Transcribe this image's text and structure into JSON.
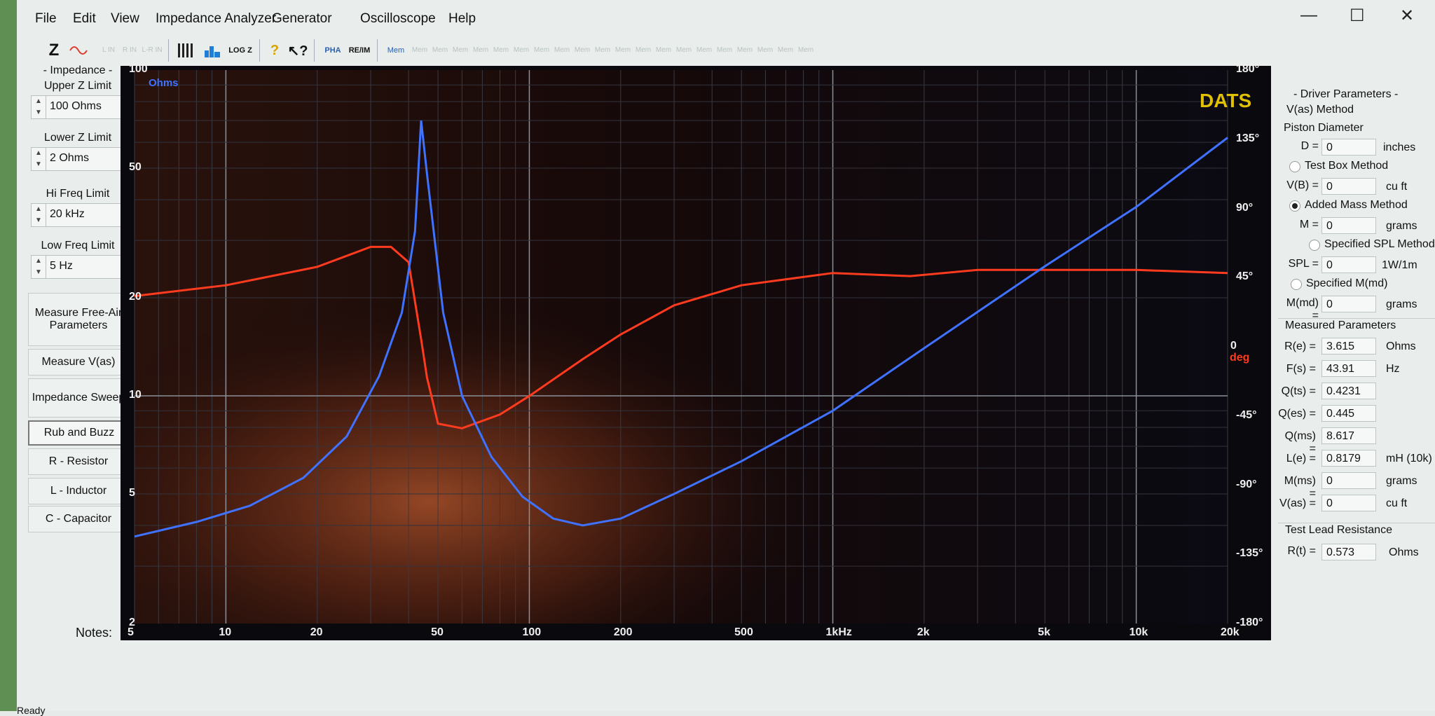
{
  "menu": [
    "File",
    "Edit",
    "View",
    "Impedance Analyzer",
    "Generator",
    "Oscilloscope",
    "Help"
  ],
  "window_controls": {
    "minimize": "—",
    "maximize": "☐",
    "close": "✕"
  },
  "toolbar": {
    "z_label": "Z",
    "ref_labels": [
      "L IN",
      "R IN",
      "L-R IN"
    ],
    "log_label": "LOG Z",
    "pha_label": "PHA",
    "reim_label": "RE/IM",
    "mem_label": "Mem",
    "mem_slots": [
      "Mem",
      "Mem",
      "Mem",
      "Mem",
      "Mem",
      "Mem",
      "Mem",
      "Mem",
      "Mem",
      "Mem",
      "Mem",
      "Mem",
      "Mem",
      "Mem",
      "Mem",
      "Mem",
      "Mem",
      "Mem",
      "Mem",
      "Mem"
    ]
  },
  "left_panel": {
    "impedance_title": "- Impedance -",
    "upper_z": {
      "label": "Upper Z Limit",
      "value": "100 Ohms"
    },
    "lower_z": {
      "label": "Lower Z Limit",
      "value": "2 Ohms"
    },
    "hi_freq": {
      "label": "Hi Freq Limit",
      "value": "20 kHz"
    },
    "low_freq": {
      "label": "Low Freq Limit",
      "value": "5 Hz"
    },
    "buttons": {
      "measure_free_air": "Measure Free-Air Parameters",
      "measure_vas": "Measure V(as)",
      "impedance_sweep": "Impedance Sweep",
      "rub_buzz": "Rub and Buzz",
      "resistor": "R - Resistor",
      "inductor": "L - Inductor",
      "capacitor": "C - Capacitor"
    }
  },
  "chart_labels": {
    "y_unit": "Ohms",
    "brand": "DATS",
    "phase_unit": "deg",
    "notes": "Notes:"
  },
  "chart_data": {
    "type": "line",
    "xlim": [
      5,
      20000
    ],
    "x_scale": "log",
    "x_ticks": [
      "5",
      "10",
      "20",
      "50",
      "100",
      "200",
      "500",
      "1kHz",
      "2k",
      "5k",
      "10k",
      "20k"
    ],
    "y_left": {
      "label": "Ohms",
      "range": [
        2,
        100
      ],
      "scale": "log",
      "ticks": [
        "2",
        "5",
        "10",
        "20",
        "50",
        "100"
      ]
    },
    "y_right": {
      "label": "deg",
      "range": [
        -180,
        180
      ],
      "ticks": [
        "180°",
        "135°",
        "90°",
        "45°",
        "0",
        "-45°",
        "-90°",
        "-135°",
        "-180°"
      ]
    },
    "grid": true,
    "series": [
      {
        "name": "",
        "color": "#3f72ff",
        "axis": "left",
        "points": [
          [
            5,
            3.7
          ],
          [
            8,
            4.1
          ],
          [
            12,
            4.6
          ],
          [
            18,
            5.6
          ],
          [
            25,
            7.5
          ],
          [
            32,
            11.5
          ],
          [
            38,
            18
          ],
          [
            42,
            32
          ],
          [
            44,
            70
          ],
          [
            46,
            48
          ],
          [
            52,
            18
          ],
          [
            60,
            10
          ],
          [
            75,
            6.5
          ],
          [
            95,
            4.9
          ],
          [
            120,
            4.2
          ],
          [
            150,
            4.0
          ],
          [
            200,
            4.2
          ],
          [
            300,
            5.0
          ],
          [
            500,
            6.3
          ],
          [
            1000,
            9.0
          ],
          [
            2000,
            14.0
          ],
          [
            5000,
            25
          ],
          [
            10000,
            38
          ],
          [
            20000,
            62
          ]
        ]
      },
      {
        "name": "",
        "color": "#ff3b1f",
        "axis": "right",
        "points": [
          [
            5,
            33
          ],
          [
            10,
            40
          ],
          [
            20,
            52
          ],
          [
            30,
            65
          ],
          [
            35,
            65
          ],
          [
            40,
            55
          ],
          [
            44,
            5
          ],
          [
            46,
            -20
          ],
          [
            50,
            -50
          ],
          [
            60,
            -53
          ],
          [
            80,
            -44
          ],
          [
            100,
            -32
          ],
          [
            150,
            -8
          ],
          [
            200,
            8
          ],
          [
            300,
            27
          ],
          [
            500,
            40
          ],
          [
            1000,
            48
          ],
          [
            1800,
            46
          ],
          [
            3000,
            50
          ],
          [
            10000,
            50
          ],
          [
            20000,
            48
          ]
        ]
      }
    ]
  },
  "right_panel": {
    "title": "- Driver Parameters -",
    "vas_method": "V(as) Method",
    "piston_diameter": "Piston Diameter",
    "d": {
      "label": "D =",
      "value": "0",
      "unit": "inches"
    },
    "test_box": "Test Box Method",
    "vb": {
      "label": "V(B) =",
      "value": "0",
      "unit": "cu ft"
    },
    "added_mass": "Added Mass Method",
    "m": {
      "label": "M =",
      "value": "0",
      "unit": "grams"
    },
    "specified_spl": "Specified SPL Method",
    "spl": {
      "label": "SPL =",
      "value": "0",
      "unit": "1W/1m"
    },
    "specified_mmd": "Specified M(md)",
    "mmd": {
      "label": "M(md) =",
      "value": "0",
      "unit": "grams"
    },
    "measured_title": "Measured Parameters",
    "measured": [
      {
        "label": "R(e) =",
        "value": "3.615",
        "unit": "Ohms"
      },
      {
        "label": "F(s) =",
        "value": "43.91",
        "unit": "Hz"
      },
      {
        "label": "Q(ts) =",
        "value": "0.4231",
        "unit": ""
      },
      {
        "label": "Q(es) =",
        "value": "0.445",
        "unit": ""
      },
      {
        "label": "Q(ms) =",
        "value": "8.617",
        "unit": ""
      },
      {
        "label": "L(e) =",
        "value": "0.8179",
        "unit": "mH (10k)"
      },
      {
        "label": "M(ms) =",
        "value": "0",
        "unit": "grams"
      },
      {
        "label": "V(as) =",
        "value": "0",
        "unit": "cu ft"
      }
    ],
    "test_lead_title": "Test Lead Resistance",
    "rt": {
      "label": "R(t) =",
      "value": "0.573",
      "unit": "Ohms"
    }
  },
  "status": {
    "text": "Ready"
  }
}
